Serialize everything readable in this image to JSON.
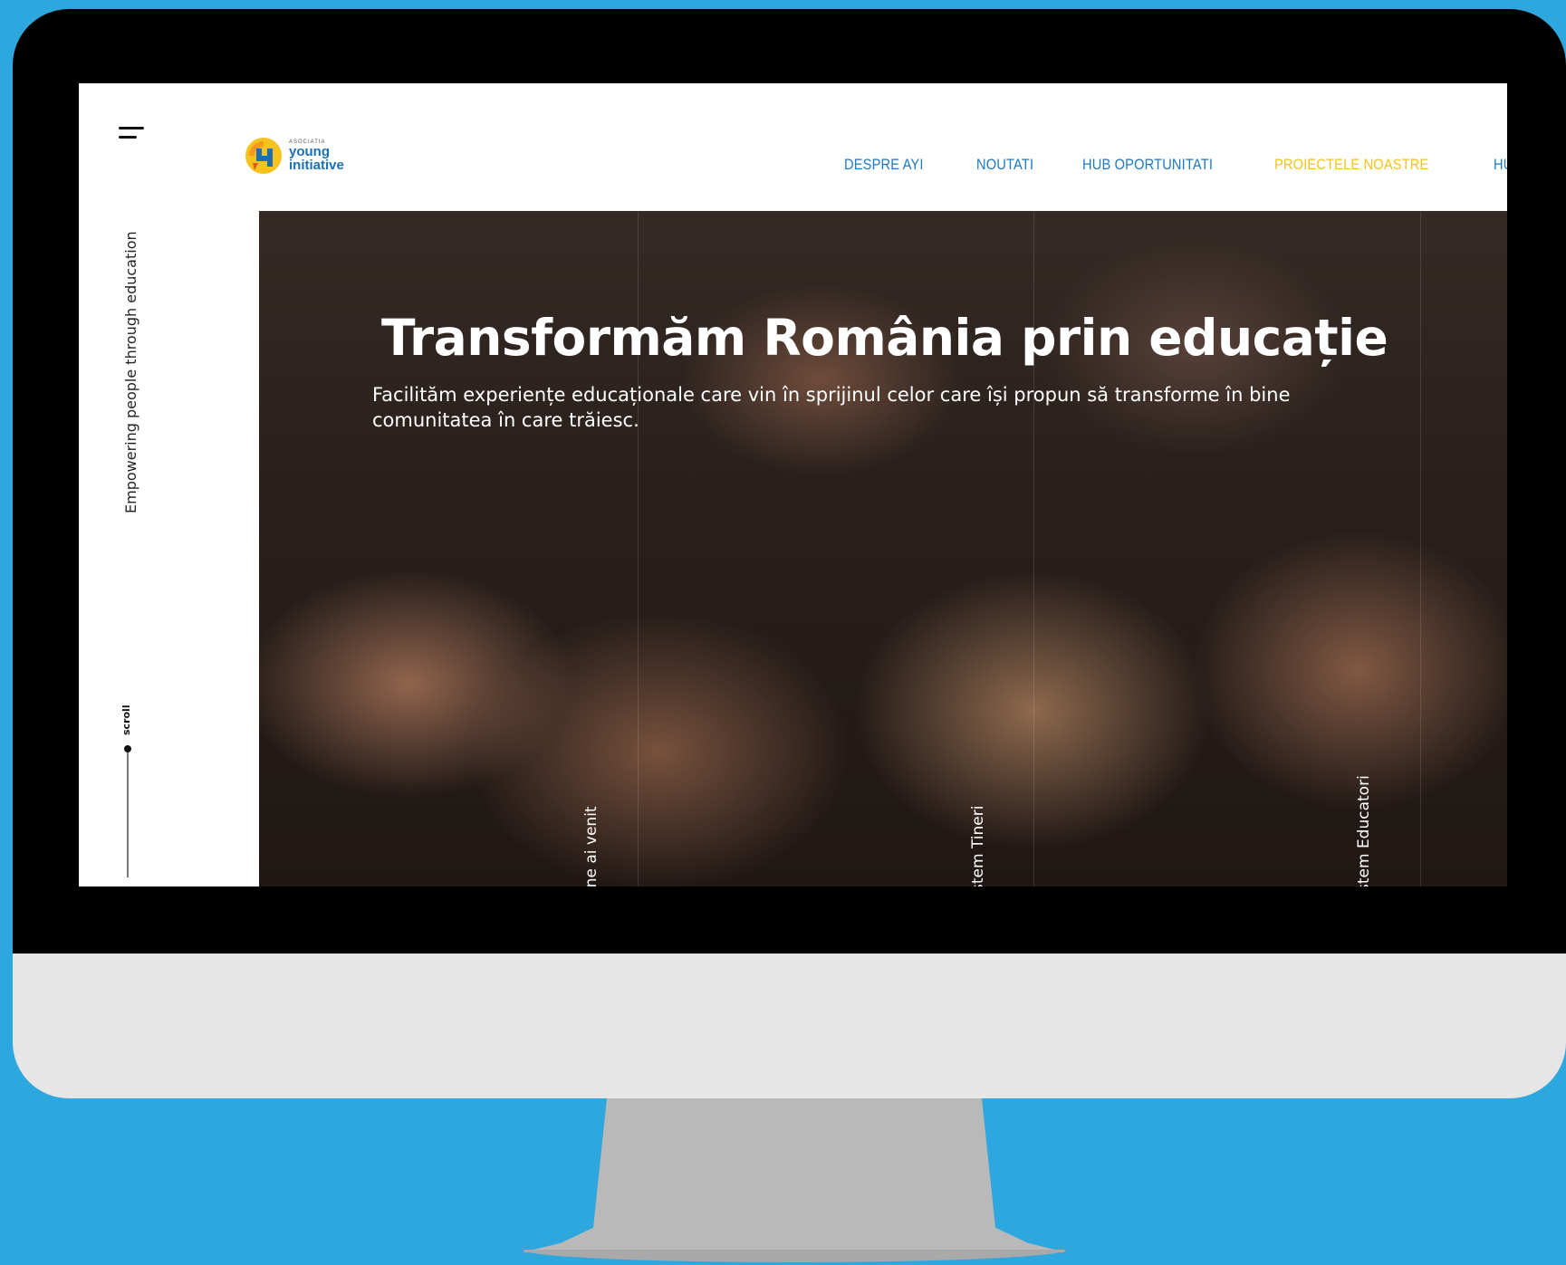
{
  "logo": {
    "small": "ASOCIATIA",
    "line1": "young",
    "line2": "initiative"
  },
  "nav": {
    "items": [
      "DESPRE AYI",
      "NOUTATI",
      "HUB OPORTUNITATI",
      "PROIECTELE NOASTRE",
      "HUB R"
    ],
    "active_index": 3
  },
  "sidebar": {
    "tagline": "Empowering people through education",
    "scroll_label": "scroll"
  },
  "hero": {
    "title": "Transformăm România prin educație",
    "subtitle": "Facilităm experiențe educaționale care vin în sprijinul celor care își propun să transforme în bine comunitatea în care trăiesc.",
    "panel_labels": [
      "ine ai venit",
      "ștem Tineri",
      "ștem Educatori"
    ]
  },
  "colors": {
    "background": "#2ea6de",
    "nav_link": "#1e78c2",
    "nav_active": "#f2c31b"
  },
  "icons": {
    "menu": "hamburger-icon",
    "logo": "young-initiative-logo"
  }
}
